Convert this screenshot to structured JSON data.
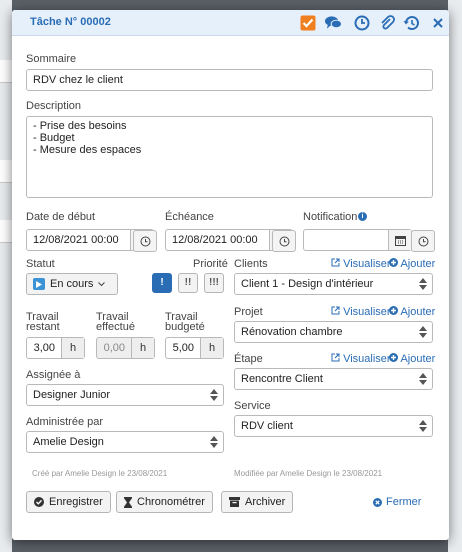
{
  "dialog": {
    "title": "Tâche N° 00002",
    "header_icons": [
      "check-square-icon",
      "comments-icon",
      "clock-icon",
      "paperclip-icon",
      "history-icon",
      "close-icon"
    ]
  },
  "fields": {
    "sommaire_label": "Sommaire",
    "sommaire_value": "RDV chez le client",
    "description_label": "Description",
    "description_lines": [
      "- Prise des besoins",
      "- Budget",
      "- Mesure des espaces"
    ],
    "date_debut_label": "Date de début",
    "date_debut_value": "12/08/2021 00:00",
    "echeance_label": "Échéance",
    "echeance_value": "12/08/2021 00:00",
    "notification_label": "Notification",
    "notification_value": "",
    "statut_label": "Statut",
    "statut_value": "En cours",
    "priorite_label": "Priorité",
    "priorite_options": [
      "!",
      "!!",
      "!!!"
    ],
    "travail_restant_label_1": "Travail",
    "travail_restant_label_2": "restant",
    "travail_restant_value": "3,00",
    "travail_effectue_label_1": "Travail",
    "travail_effectue_label_2": "effectué",
    "travail_effectue_value": "0,00",
    "travail_budgete_label_1": "Travail",
    "travail_budgete_label_2": "budgeté",
    "travail_budgete_value": "5,00",
    "unit": "h",
    "assignee_label": "Assignée à",
    "assignee_value": "Designer Junior",
    "administree_label": "Administrée par",
    "administree_value": "Amelie Design",
    "clients_label": "Clients",
    "clients_value": "Client 1 - Design d'intérieur",
    "projet_label": "Projet",
    "projet_value": "Rénovation chambre",
    "etape_label": "Étape",
    "etape_value": "Rencontre Client",
    "service_label": "Service",
    "service_value": "RDV client",
    "visualiser": "Visualiser",
    "ajouter": "Ajouter"
  },
  "meta": {
    "created": "Créé par Amelie Design le 23/08/2021",
    "modified": "Modifiée par Amelie Design le 23/08/2021"
  },
  "buttons": {
    "save": "Enregistrer",
    "timer": "Chronométrer",
    "archive": "Archiver",
    "close": "Fermer"
  },
  "colors": {
    "accent": "#2a6db5",
    "check_orange": "#f0801f",
    "header_bg": "#e6f0fb",
    "priority_active": "#2a6db5"
  }
}
